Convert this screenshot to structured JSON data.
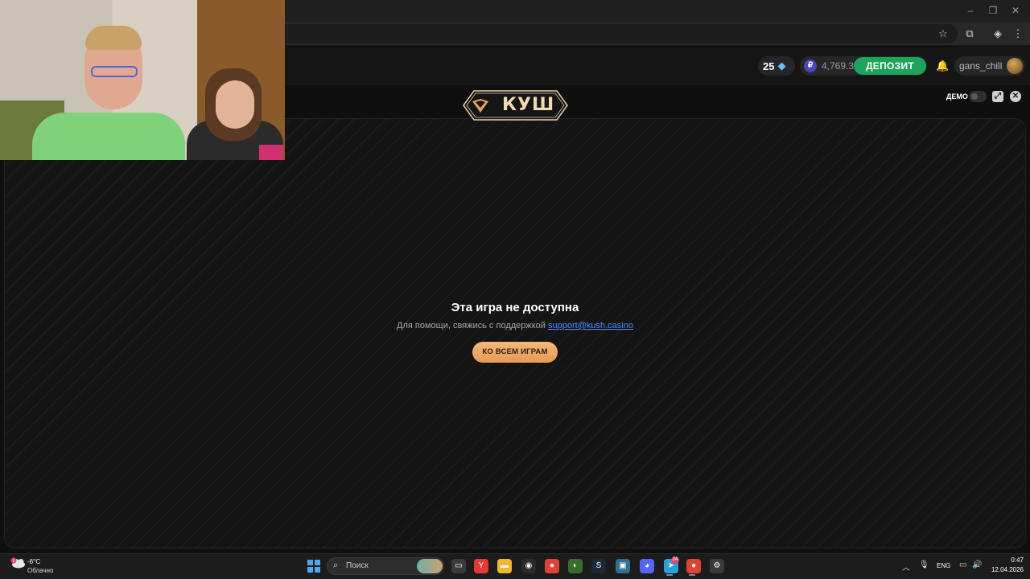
{
  "browser": {
    "url_fragment": "ls",
    "window_controls": [
      "–",
      "❐",
      "✕"
    ]
  },
  "header": {
    "gems_count": "25",
    "balance": "4,769.3",
    "currency_symbol": "₽",
    "deposit_label": "ДЕПОЗИТ",
    "username": "gans_chill",
    "colors": {
      "deposit": "#1ea35a",
      "gem": "#5ec6ff",
      "currency_badge": "#4b47b8"
    }
  },
  "game": {
    "logo_text": "КУШ",
    "demo_label": "ДЕМО",
    "message_title": "Эта игра не доступна",
    "message_help": "Для помощи, свяжись с поддержкой",
    "support_email": "support@kush.casino",
    "all_games_label": "КО ВСЕМ ИГРАМ",
    "colors": {
      "accent": "#e9a35f",
      "link": "#4d8dff"
    }
  },
  "taskbar": {
    "weather_temp": "-6°C",
    "weather_desc": "Облачно",
    "weather_badge": "1",
    "search_placeholder": "Поиск",
    "language": "ENG",
    "time": "0:47",
    "date": "12.04.2026",
    "apps": [
      {
        "name": "task-view-icon",
        "glyph": "▭",
        "color": "#3a3a3a"
      },
      {
        "name": "yandex-browser-icon",
        "glyph": "Y",
        "color": "#e53935"
      },
      {
        "name": "file-explorer-icon",
        "glyph": "▬",
        "color": "#f2b632"
      },
      {
        "name": "obs-icon",
        "glyph": "◉",
        "color": "#2a2a2a"
      },
      {
        "name": "chrome-icon",
        "glyph": "●",
        "color": "#db4437"
      },
      {
        "name": "app-green-icon",
        "glyph": "◐",
        "color": "#3a6b2a"
      },
      {
        "name": "steam-icon",
        "glyph": "S",
        "color": "#1b2838"
      },
      {
        "name": "monitor-app-icon",
        "glyph": "▣",
        "color": "#2f6f8f"
      },
      {
        "name": "discord-icon",
        "glyph": "◕",
        "color": "#5865f2"
      },
      {
        "name": "telegram-icon",
        "glyph": "➤",
        "color": "#2aa1da"
      },
      {
        "name": "chrome-profile-icon",
        "glyph": "●",
        "color": "#db4437"
      },
      {
        "name": "settings-icon",
        "glyph": "⚙",
        "color": "#3a3a3a"
      }
    ],
    "badges": {
      "discord": "",
      "telegram": "24",
      "chrome-profile": ""
    }
  }
}
